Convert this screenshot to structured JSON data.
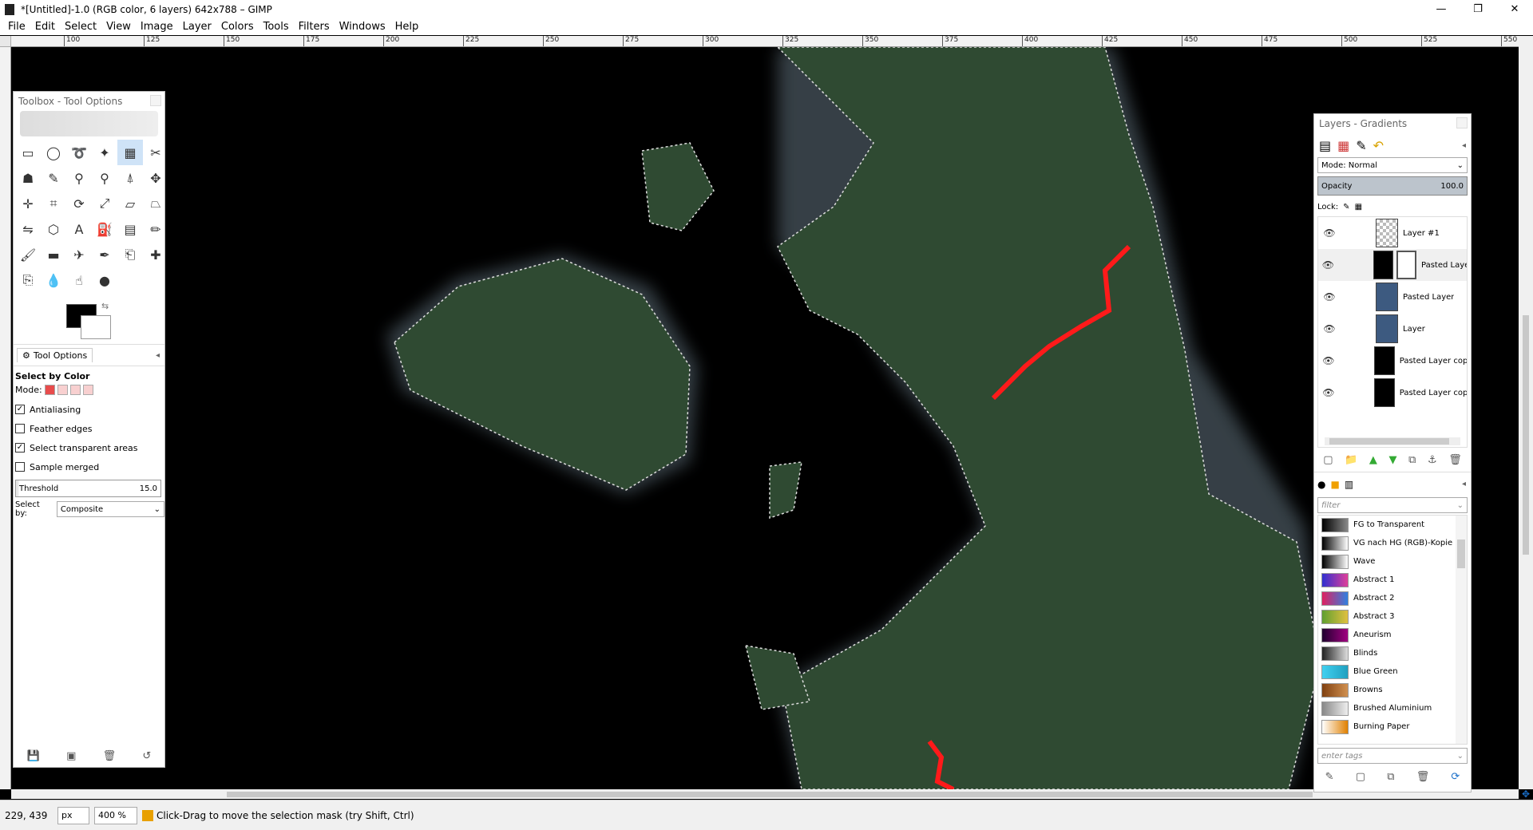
{
  "window": {
    "title": "*[Untitled]-1.0 (RGB color, 6 layers) 642x788 – GIMP",
    "minimize": "—",
    "maximize": "❐",
    "close": "✕"
  },
  "menu": [
    "File",
    "Edit",
    "Select",
    "View",
    "Image",
    "Layer",
    "Colors",
    "Tools",
    "Filters",
    "Windows",
    "Help"
  ],
  "ruler_ticks": [
    "100",
    "125",
    "150",
    "175",
    "200",
    "225",
    "250",
    "275",
    "300",
    "325",
    "350",
    "375",
    "400",
    "425",
    "450",
    "475",
    "500",
    "525",
    "550"
  ],
  "toolbox": {
    "title": "Toolbox - Tool Options",
    "tab_label": "Tool Options",
    "tool_name": "Select by Color",
    "mode_label": "Mode:",
    "options": [
      {
        "label": "Antialiasing",
        "checked": true
      },
      {
        "label": "Feather edges",
        "checked": false
      },
      {
        "label": "Select transparent areas",
        "checked": true
      },
      {
        "label": "Sample merged",
        "checked": false
      }
    ],
    "threshold_label": "Threshold",
    "threshold_value": "15.0",
    "select_by_label": "Select by:",
    "select_by_value": "Composite"
  },
  "layers": {
    "title": "Layers - Gradients",
    "mode_label": "Mode: Normal",
    "opacity_label": "Opacity",
    "opacity_value": "100.0",
    "lock_label": "Lock:",
    "items": [
      {
        "name": "Layer #1"
      },
      {
        "name": "Pasted Layer"
      },
      {
        "name": "Pasted Layer"
      },
      {
        "name": "Layer"
      },
      {
        "name": "Pasted Layer copy"
      },
      {
        "name": "Pasted Layer copy"
      }
    ]
  },
  "gradients": {
    "filter_placeholder": "filter",
    "tags_placeholder": "enter tags",
    "items": [
      {
        "name": "FG to Transparent",
        "colors": "#000,#888"
      },
      {
        "name": "VG nach HG (RGB)-Kopie",
        "colors": "#000,#fff"
      },
      {
        "name": "Wave",
        "colors": "#000,#fff"
      },
      {
        "name": "Abstract 1",
        "colors": "#3030d0,#e0409a"
      },
      {
        "name": "Abstract 2",
        "colors": "#e02060,#3080e0"
      },
      {
        "name": "Abstract 3",
        "colors": "#60a030,#e0c040"
      },
      {
        "name": "Aneurism",
        "colors": "#200030,#a00080"
      },
      {
        "name": "Blinds",
        "colors": "#222,#ddd"
      },
      {
        "name": "Blue Green",
        "colors": "#40d0f0,#20a0c0"
      },
      {
        "name": "Browns",
        "colors": "#804010,#d09050"
      },
      {
        "name": "Brushed Aluminium",
        "colors": "#888,#eee"
      },
      {
        "name": "Burning Paper",
        "colors": "#fff,#e08000"
      }
    ]
  },
  "status": {
    "coords": "229, 439",
    "unit": "px",
    "zoom": "400 %",
    "message": "Click-Drag to move the selection mask (try Shift, Ctrl)"
  }
}
